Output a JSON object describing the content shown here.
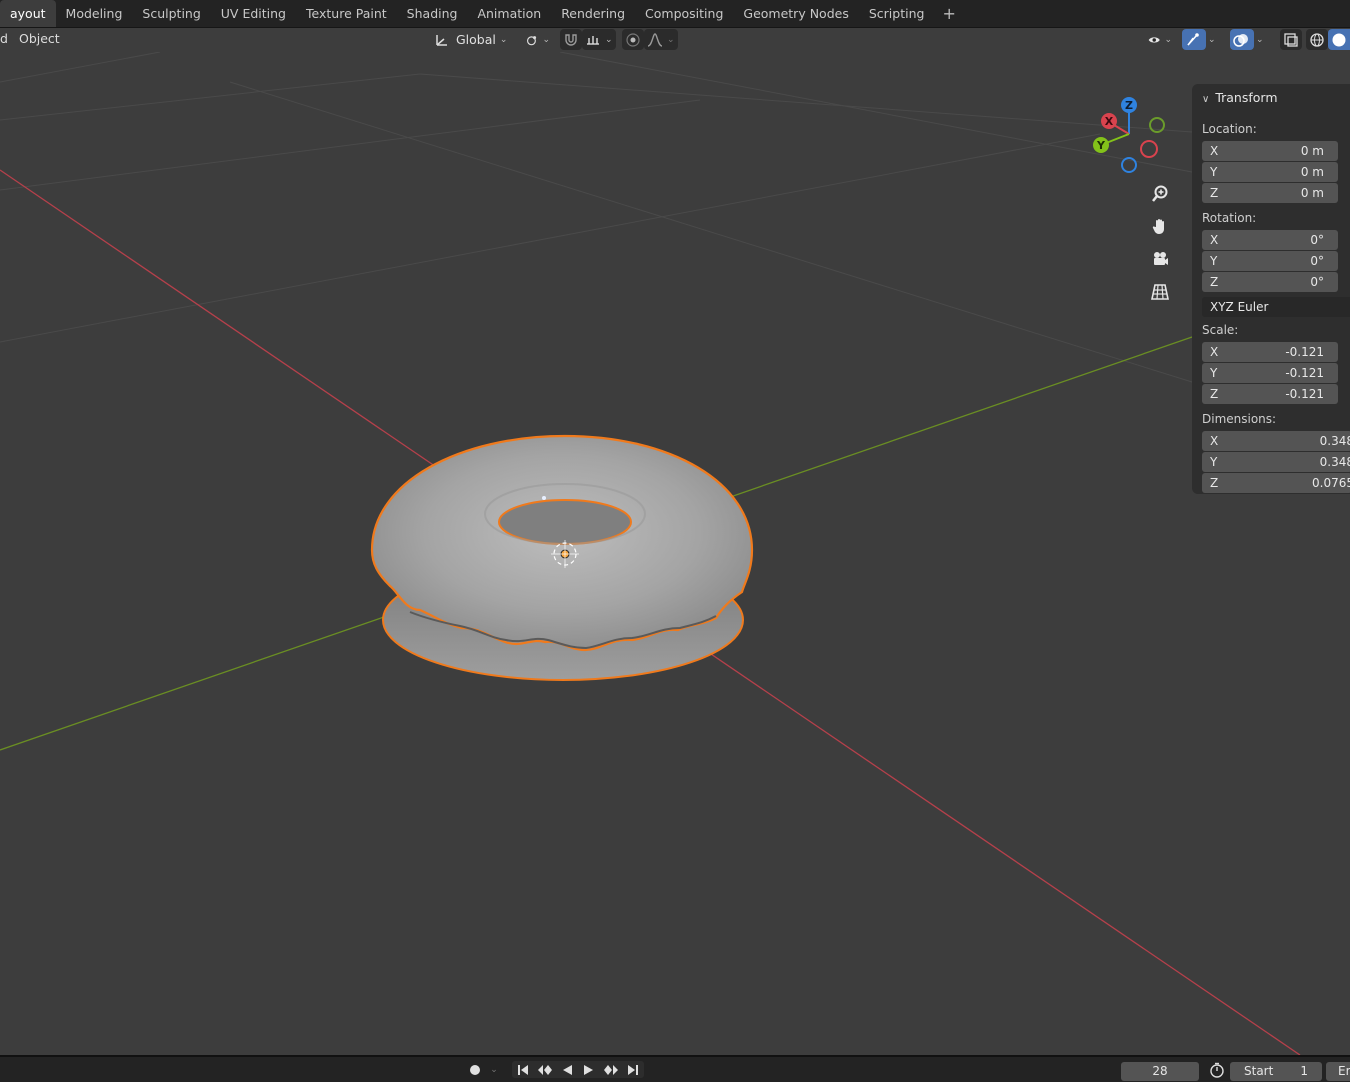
{
  "workspace_tabs": [
    "ayout",
    "Modeling",
    "Sculpting",
    "UV Editing",
    "Texture Paint",
    "Shading",
    "Animation",
    "Rendering",
    "Compositing",
    "Geometry Nodes",
    "Scripting"
  ],
  "add_tab": "+",
  "header": {
    "mode_fragment": "d",
    "object_menu": "Object",
    "orientation": "Global"
  },
  "gizmo": {
    "x": "X",
    "y": "Y",
    "z": "Z"
  },
  "transform": {
    "title": "Transform",
    "location_label": "Location:",
    "location": [
      {
        "axis": "X",
        "value": "0 m"
      },
      {
        "axis": "Y",
        "value": "0 m"
      },
      {
        "axis": "Z",
        "value": "0 m"
      }
    ],
    "rotation_label": "Rotation:",
    "rotation": [
      {
        "axis": "X",
        "value": "0°"
      },
      {
        "axis": "Y",
        "value": "0°"
      },
      {
        "axis": "Z",
        "value": "0°"
      }
    ],
    "rotation_mode": "XYZ Euler",
    "scale_label": "Scale:",
    "scale": [
      {
        "axis": "X",
        "value": "-0.121"
      },
      {
        "axis": "Y",
        "value": "-0.121"
      },
      {
        "axis": "Z",
        "value": "-0.121"
      }
    ],
    "dimensions_label": "Dimensions:",
    "dimensions": [
      {
        "axis": "X",
        "value": "0.348"
      },
      {
        "axis": "Y",
        "value": "0.348"
      },
      {
        "axis": "Z",
        "value": "0.0765"
      }
    ]
  },
  "timeline": {
    "current_frame": "28",
    "start_label": "Start",
    "start_value": "1",
    "end_fragment": "Er"
  },
  "colors": {
    "x_axis": "#b5404b",
    "y_axis": "#6a8e23",
    "selection_outline": "#f07a1c",
    "gizmo_x": "#d9434e",
    "gizmo_y": "#83c21a",
    "gizmo_z": "#2f83e0"
  }
}
